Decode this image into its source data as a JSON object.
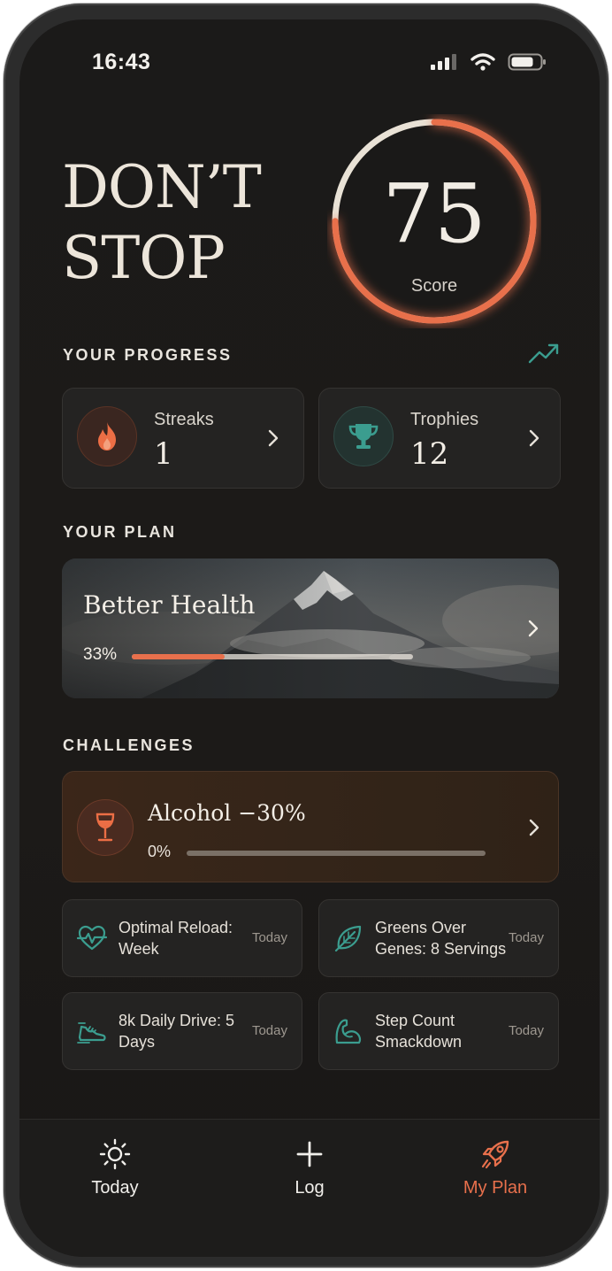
{
  "status_bar": {
    "time": "16:43"
  },
  "hero": {
    "line1": "DON’T",
    "line2": "STOP",
    "score_value": "75",
    "score_label": "Score",
    "score_fraction": 0.75
  },
  "progress": {
    "title": "YOUR PROGRESS",
    "streaks": {
      "label": "Streaks",
      "value": "1"
    },
    "trophies": {
      "label": "Trophies",
      "value": "12"
    }
  },
  "plan": {
    "title": "YOUR PLAN",
    "name": "Better Health",
    "percent_label": "33%",
    "progress": 0.33
  },
  "challenges": {
    "title": "CHALLENGES",
    "featured": {
      "name": "Alcohol −30%",
      "percent_label": "0%",
      "progress": 0
    },
    "items": [
      {
        "label": "Optimal Reload: Week",
        "when": "Today",
        "icon": "heart-pulse-icon"
      },
      {
        "label": "Greens Over Genes: 8 Servings",
        "when": "Today",
        "icon": "leaf-icon"
      },
      {
        "label": "8k Daily Drive: 5 Days",
        "when": "Today",
        "icon": "sneaker-icon"
      },
      {
        "label": "Step Count Smackdown",
        "when": "Today",
        "icon": "flexed-arm-icon"
      }
    ]
  },
  "tabs": [
    {
      "label": "Today",
      "icon": "sun-icon",
      "active": false
    },
    {
      "label": "Log",
      "icon": "plus-icon",
      "active": false
    },
    {
      "label": "My Plan",
      "icon": "rocket-icon",
      "active": true
    }
  ],
  "colors": {
    "accent": "#e8704c",
    "teal": "#3b9d8f",
    "background": "#1b1a19",
    "text": "#ece6dd"
  }
}
